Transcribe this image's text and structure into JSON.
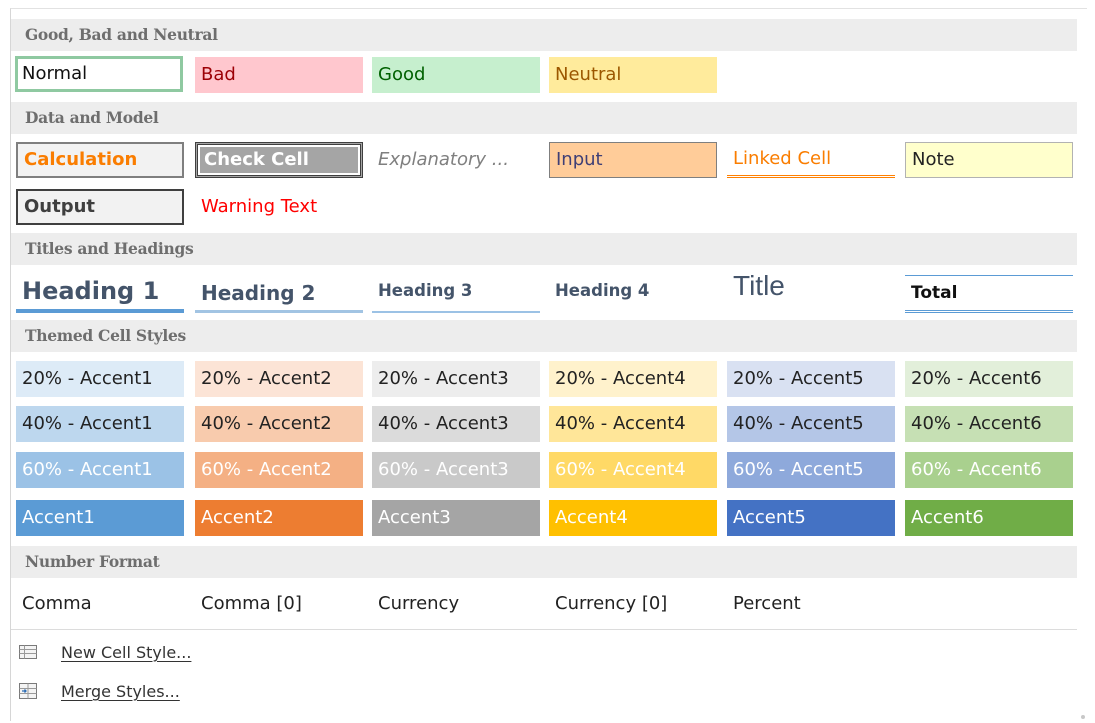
{
  "sections": {
    "good_bad_neutral": "Good, Bad and Neutral",
    "data_model": "Data and Model",
    "titles_headings": "Titles and Headings",
    "themed": "Themed Cell Styles",
    "number_format": "Number Format"
  },
  "good_bad_neutral": {
    "normal": "Normal",
    "bad": "Bad",
    "good": "Good",
    "neutral": "Neutral"
  },
  "data_model": {
    "calculation": "Calculation",
    "check_cell": "Check Cell",
    "explanatory": "Explanatory ...",
    "input": "Input",
    "linked_cell": "Linked Cell",
    "note": "Note",
    "output": "Output",
    "warning_text": "Warning Text"
  },
  "titles_headings": {
    "heading1": "Heading 1",
    "heading2": "Heading 2",
    "heading3": "Heading 3",
    "heading4": "Heading 4",
    "title": "Title",
    "total": "Total"
  },
  "themed": {
    "row20": [
      "20% - Accent1",
      "20% - Accent2",
      "20% - Accent3",
      "20% - Accent4",
      "20% - Accent5",
      "20% - Accent6"
    ],
    "row40": [
      "40% - Accent1",
      "40% - Accent2",
      "40% - Accent3",
      "40% - Accent4",
      "40% - Accent5",
      "40% - Accent6"
    ],
    "row60": [
      "60% - Accent1",
      "60% - Accent2",
      "60% - Accent3",
      "60% - Accent4",
      "60% - Accent5",
      "60% - Accent6"
    ],
    "accent": [
      "Accent1",
      "Accent2",
      "Accent3",
      "Accent4",
      "Accent5",
      "Accent6"
    ]
  },
  "number_format": {
    "comma": "Comma",
    "comma0": "Comma [0]",
    "currency": "Currency",
    "currency0": "Currency [0]",
    "percent": "Percent"
  },
  "menu": {
    "new_cell_style": "New Cell Style...",
    "merge_styles": "Merge Styles...",
    "new_icon": "new-cell-style-icon",
    "merge_icon": "merge-styles-icon"
  },
  "colors": {
    "accent1": "#5b9bd5",
    "accent2": "#ed7d31",
    "accent3": "#a5a5a5",
    "accent4": "#ffc000",
    "accent5": "#4472c4",
    "accent6": "#70ad47"
  }
}
